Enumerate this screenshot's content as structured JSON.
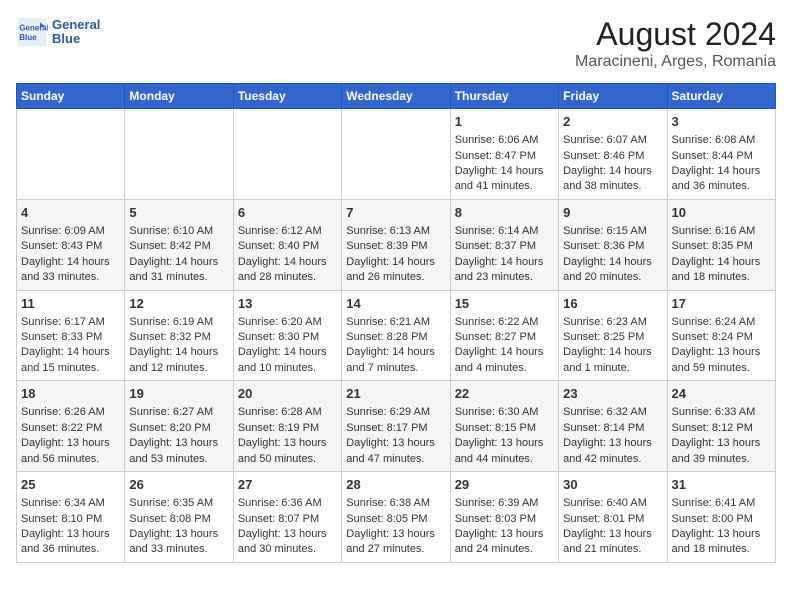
{
  "logo": {
    "line1": "General",
    "line2": "Blue"
  },
  "title": "August 2024",
  "subtitle": "Maracineni, Arges, Romania",
  "weekdays": [
    "Sunday",
    "Monday",
    "Tuesday",
    "Wednesday",
    "Thursday",
    "Friday",
    "Saturday"
  ],
  "weeks": [
    [
      {
        "day": "",
        "text": ""
      },
      {
        "day": "",
        "text": ""
      },
      {
        "day": "",
        "text": ""
      },
      {
        "day": "",
        "text": ""
      },
      {
        "day": "1",
        "text": "Sunrise: 6:06 AM\nSunset: 8:47 PM\nDaylight: 14 hours and 41 minutes."
      },
      {
        "day": "2",
        "text": "Sunrise: 6:07 AM\nSunset: 8:46 PM\nDaylight: 14 hours and 38 minutes."
      },
      {
        "day": "3",
        "text": "Sunrise: 6:08 AM\nSunset: 8:44 PM\nDaylight: 14 hours and 36 minutes."
      }
    ],
    [
      {
        "day": "4",
        "text": "Sunrise: 6:09 AM\nSunset: 8:43 PM\nDaylight: 14 hours and 33 minutes."
      },
      {
        "day": "5",
        "text": "Sunrise: 6:10 AM\nSunset: 8:42 PM\nDaylight: 14 hours and 31 minutes."
      },
      {
        "day": "6",
        "text": "Sunrise: 6:12 AM\nSunset: 8:40 PM\nDaylight: 14 hours and 28 minutes."
      },
      {
        "day": "7",
        "text": "Sunrise: 6:13 AM\nSunset: 8:39 PM\nDaylight: 14 hours and 26 minutes."
      },
      {
        "day": "8",
        "text": "Sunrise: 6:14 AM\nSunset: 8:37 PM\nDaylight: 14 hours and 23 minutes."
      },
      {
        "day": "9",
        "text": "Sunrise: 6:15 AM\nSunset: 8:36 PM\nDaylight: 14 hours and 20 minutes."
      },
      {
        "day": "10",
        "text": "Sunrise: 6:16 AM\nSunset: 8:35 PM\nDaylight: 14 hours and 18 minutes."
      }
    ],
    [
      {
        "day": "11",
        "text": "Sunrise: 6:17 AM\nSunset: 8:33 PM\nDaylight: 14 hours and 15 minutes."
      },
      {
        "day": "12",
        "text": "Sunrise: 6:19 AM\nSunset: 8:32 PM\nDaylight: 14 hours and 12 minutes."
      },
      {
        "day": "13",
        "text": "Sunrise: 6:20 AM\nSunset: 8:30 PM\nDaylight: 14 hours and 10 minutes."
      },
      {
        "day": "14",
        "text": "Sunrise: 6:21 AM\nSunset: 8:28 PM\nDaylight: 14 hours and 7 minutes."
      },
      {
        "day": "15",
        "text": "Sunrise: 6:22 AM\nSunset: 8:27 PM\nDaylight: 14 hours and 4 minutes."
      },
      {
        "day": "16",
        "text": "Sunrise: 6:23 AM\nSunset: 8:25 PM\nDaylight: 14 hours and 1 minute."
      },
      {
        "day": "17",
        "text": "Sunrise: 6:24 AM\nSunset: 8:24 PM\nDaylight: 13 hours and 59 minutes."
      }
    ],
    [
      {
        "day": "18",
        "text": "Sunrise: 6:26 AM\nSunset: 8:22 PM\nDaylight: 13 hours and 56 minutes."
      },
      {
        "day": "19",
        "text": "Sunrise: 6:27 AM\nSunset: 8:20 PM\nDaylight: 13 hours and 53 minutes."
      },
      {
        "day": "20",
        "text": "Sunrise: 6:28 AM\nSunset: 8:19 PM\nDaylight: 13 hours and 50 minutes."
      },
      {
        "day": "21",
        "text": "Sunrise: 6:29 AM\nSunset: 8:17 PM\nDaylight: 13 hours and 47 minutes."
      },
      {
        "day": "22",
        "text": "Sunrise: 6:30 AM\nSunset: 8:15 PM\nDaylight: 13 hours and 44 minutes."
      },
      {
        "day": "23",
        "text": "Sunrise: 6:32 AM\nSunset: 8:14 PM\nDaylight: 13 hours and 42 minutes."
      },
      {
        "day": "24",
        "text": "Sunrise: 6:33 AM\nSunset: 8:12 PM\nDaylight: 13 hours and 39 minutes."
      }
    ],
    [
      {
        "day": "25",
        "text": "Sunrise: 6:34 AM\nSunset: 8:10 PM\nDaylight: 13 hours and 36 minutes."
      },
      {
        "day": "26",
        "text": "Sunrise: 6:35 AM\nSunset: 8:08 PM\nDaylight: 13 hours and 33 minutes."
      },
      {
        "day": "27",
        "text": "Sunrise: 6:36 AM\nSunset: 8:07 PM\nDaylight: 13 hours and 30 minutes."
      },
      {
        "day": "28",
        "text": "Sunrise: 6:38 AM\nSunset: 8:05 PM\nDaylight: 13 hours and 27 minutes."
      },
      {
        "day": "29",
        "text": "Sunrise: 6:39 AM\nSunset: 8:03 PM\nDaylight: 13 hours and 24 minutes."
      },
      {
        "day": "30",
        "text": "Sunrise: 6:40 AM\nSunset: 8:01 PM\nDaylight: 13 hours and 21 minutes."
      },
      {
        "day": "31",
        "text": "Sunrise: 6:41 AM\nSunset: 8:00 PM\nDaylight: 13 hours and 18 minutes."
      }
    ]
  ]
}
